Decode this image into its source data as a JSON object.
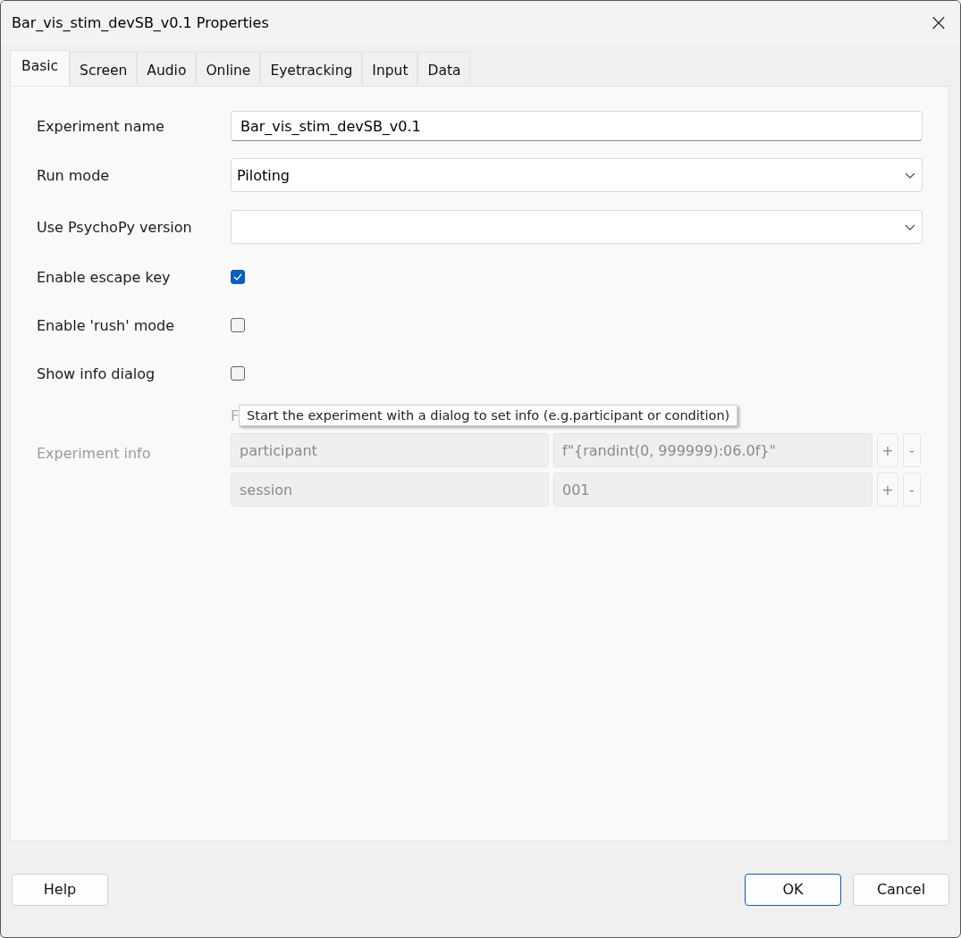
{
  "window": {
    "title": "Bar_vis_stim_devSB_v0.1 Properties",
    "close": "×"
  },
  "tabs": [
    {
      "label": "Basic",
      "selected": true
    },
    {
      "label": "Screen",
      "selected": false
    },
    {
      "label": "Audio",
      "selected": false
    },
    {
      "label": "Online",
      "selected": false
    },
    {
      "label": "Eyetracking",
      "selected": false
    },
    {
      "label": "Input",
      "selected": false
    },
    {
      "label": "Data",
      "selected": false
    }
  ],
  "fields": [
    {
      "kind": "text",
      "label": "Experiment name",
      "value": "Bar_vis_stim_devSB_v0.1"
    },
    {
      "kind": "dropdown",
      "label": "Run mode",
      "value": "Piloting"
    },
    {
      "kind": "dropdown",
      "label": "Use PsychoPy version"
    },
    {
      "kind": "checkbox",
      "label": "Enable escape key",
      "checked": true
    },
    {
      "kind": "checkbox",
      "label": "Enable 'rush' mode",
      "checked": false
    },
    {
      "kind": "checkbox",
      "label": "Show info dialog",
      "checked": false
    }
  ],
  "covered_label": "F",
  "tooltip": "Start the experiment with a dialog to set info (e.g.participant or condition)",
  "experiment_info": {
    "label": "Experiment info",
    "disabled": true,
    "rows": [
      {
        "key": "participant",
        "value": "f\"{randint(0, 999999):06.0f}\"",
        "add": "+",
        "remove": "-"
      },
      {
        "key": "session",
        "value": "001",
        "add": "+",
        "remove": "-"
      }
    ]
  },
  "buttons": {
    "help": "Help",
    "ok": "OK",
    "cancel": "Cancel"
  }
}
